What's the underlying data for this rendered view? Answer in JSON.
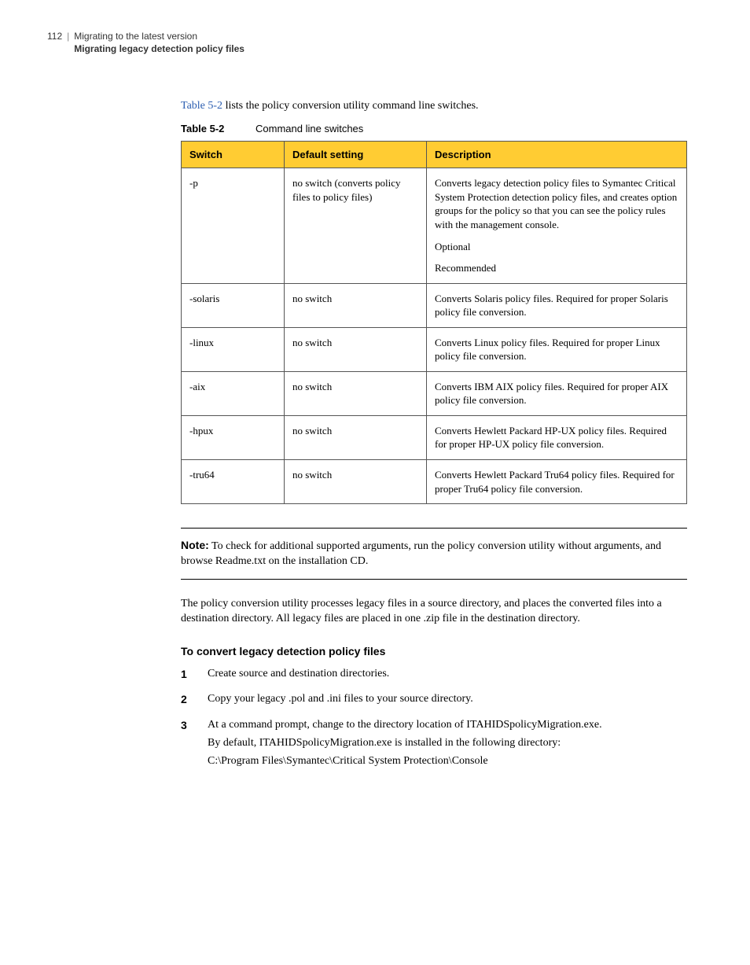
{
  "header": {
    "page": "112",
    "line1": "Migrating to the latest version",
    "line2": "Migrating legacy detection policy files"
  },
  "intro": {
    "tableref": "Table 5-2",
    "rest": " lists the policy conversion utility command line switches."
  },
  "tableCaption": {
    "label": "Table 5-2",
    "caption": "Command line switches"
  },
  "table": {
    "headers": [
      "Switch",
      "Default setting",
      "Description"
    ],
    "rows": [
      {
        "c0": "-p",
        "c1": "no switch (converts policy files to policy files)",
        "desc": [
          "Converts legacy detection policy files to Symantec Critical System Protection detection policy files, and creates option groups for the policy so that you can see the policy rules with the management console.",
          "Optional",
          "Recommended"
        ]
      },
      {
        "c0": "-solaris",
        "c1": "no switch",
        "desc": [
          "Converts Solaris policy files. Required for proper Solaris policy file conversion."
        ]
      },
      {
        "c0": "-linux",
        "c1": "no switch",
        "desc": [
          "Converts Linux policy files. Required for proper Linux policy file conversion."
        ]
      },
      {
        "c0": "-aix",
        "c1": "no switch",
        "desc": [
          "Converts IBM AIX policy files. Required for proper AIX policy file conversion."
        ]
      },
      {
        "c0": "-hpux",
        "c1": "no switch",
        "desc": [
          "Converts Hewlett Packard HP-UX policy files. Required for proper HP-UX policy file conversion."
        ]
      },
      {
        "c0": "-tru64",
        "c1": "no switch",
        "desc": [
          "Converts Hewlett Packard Tru64 policy files. Required for proper Tru64 policy file conversion."
        ]
      }
    ]
  },
  "note": {
    "label": "Note:",
    "text": " To check for additional supported arguments, run the policy conversion utility without arguments, and browse Readme.txt on the installation CD."
  },
  "bodyPara": "The policy conversion utility processes legacy files in a source directory, and places the converted files into a destination directory. All legacy files are placed in one .zip file in the destination directory.",
  "procHead": "To convert legacy detection policy files",
  "steps": [
    {
      "num": "1",
      "lines": [
        "Create source and destination directories."
      ]
    },
    {
      "num": "2",
      "lines": [
        "Copy your legacy .pol and .ini files to your source directory."
      ]
    },
    {
      "num": "3",
      "lines": [
        "At a command prompt, change to the directory location of ITAHIDSpolicyMigration.exe.",
        "By default, ITAHIDSpolicyMigration.exe is installed in the following directory:",
        "C:\\Program Files\\Symantec\\Critical System Protection\\Console"
      ]
    }
  ]
}
